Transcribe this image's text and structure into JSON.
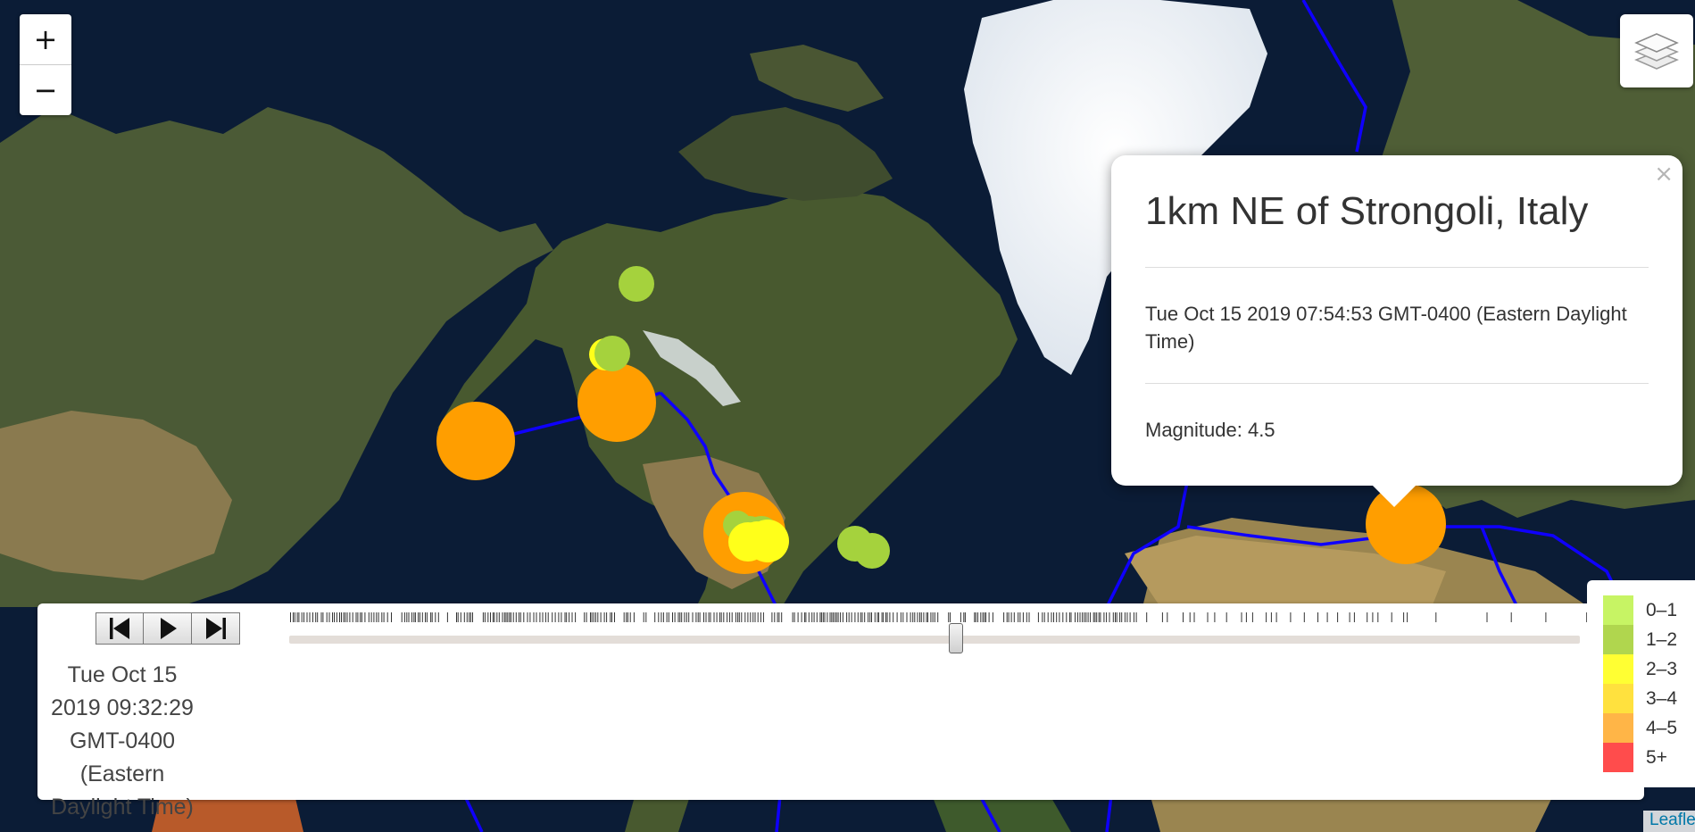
{
  "map": {
    "controls": {
      "zoom_in": "+",
      "zoom_out": "−",
      "layers_icon": "layers-icon"
    },
    "popup": {
      "title": "1km NE of Strongoli, Italy",
      "time": "Tue Oct 15 2019 07:54:53 GMT-0400 (Eastern Daylight Time)",
      "magnitude": "Magnitude: 4.5",
      "close": "×"
    },
    "timeline": {
      "current_time": "Tue Oct 15 2019 09:32:29 GMT-0400 (Eastern Daylight Time)",
      "buttons": [
        "previous-icon",
        "play-icon",
        "next-icon"
      ],
      "slider_position": 0.51
    },
    "legend": [
      {
        "label": "0–1",
        "color": "#c7f464"
      },
      {
        "label": "1–2",
        "color": "#b0d64e"
      },
      {
        "label": "2–3",
        "color": "#ffff33"
      },
      {
        "label": "3–4",
        "color": "#ffe13e"
      },
      {
        "label": "4–5",
        "color": "#ffb547"
      },
      {
        "label": "5+",
        "color": "#ff4c4c"
      }
    ],
    "marker_colors": {
      "orange": "#ff9e00",
      "yellow": "#ffff1a",
      "green": "#a5d23d"
    },
    "plate_boundary_color": "#0f00ff",
    "attribution": "Leaflet"
  }
}
